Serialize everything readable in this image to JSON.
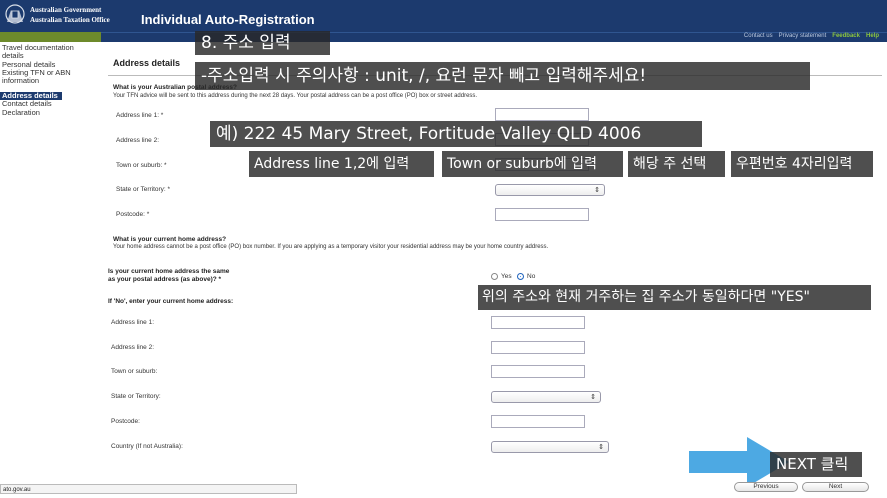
{
  "header": {
    "gov_line1": "Australian Government",
    "gov_line2": "Australian Taxation Office",
    "app_title": "Individual Auto-Registration",
    "bg_color": "#1c3a6e"
  },
  "toplinks": {
    "contact": "Contact us",
    "privacy": "Privacy statement",
    "feedback": "Feedback",
    "help": "Help"
  },
  "sidebar": {
    "items": [
      {
        "label": "Travel documentation"
      },
      {
        "label": "details"
      },
      {
        "label": "Personal details"
      },
      {
        "label": "Existing TFN or ABN"
      },
      {
        "label": "information"
      },
      {
        "label": "Address details",
        "active": true
      },
      {
        "label": "Contact details"
      },
      {
        "label": "Declaration"
      }
    ]
  },
  "main": {
    "section_title": "Address details",
    "postal": {
      "question": "What is your Australian postal address?",
      "note": "Your TFN advice will be sent to this address during the next 28 days. Your postal address can be a post office (PO) box or street address.",
      "line1_label": "Address line 1: *",
      "line2_label": "Address line 2:",
      "town_label": "Town or suburb: *",
      "state_label": "State or Territory: *",
      "postcode_label": "Postcode: *"
    },
    "home": {
      "question": "What is your current home address?",
      "note": "Your home address cannot be a post office (PO) box number. If you are applying as a temporary visitor your residential address may be your home country address.",
      "same_q1": "Is your current home address the same",
      "same_q2": "as your postal address (as above)? *",
      "yes_label": "Yes",
      "no_label": "No",
      "selected": "No",
      "if_no": "If 'No', enter your current home address:",
      "line1_label": "Address line 1:",
      "line2_label": "Address line 2:",
      "town_label": "Town or suburb:",
      "state_label": "State or Territory:",
      "postcode_label": "Postcode:",
      "country_label": "Country (If not Australia):"
    }
  },
  "overlays": {
    "step": "8. 주소 입력",
    "warning": "-주소입력 시 주의사항 : unit, /, 요런 문자 빼고 입력해주세요!",
    "example": "예)  222 45 Mary Street, Fortitude Valley QLD 4006",
    "lines_hint": "Address line 1,2에 입력",
    "town_hint": "Town or suburb에 입력",
    "state_hint": "해당 주 선택",
    "postcode_hint": "우편번호 4자리입력",
    "same_hint": "위의 주소와 현재 거주하는 집 주소가 동일하다면 \"YES\"",
    "next_hint": "NEXT 클릭",
    "arrow_color": "#3aa0e0"
  },
  "footer": {
    "status_url": "ato.gov.au",
    "previous": "Previous",
    "next": "Next"
  }
}
